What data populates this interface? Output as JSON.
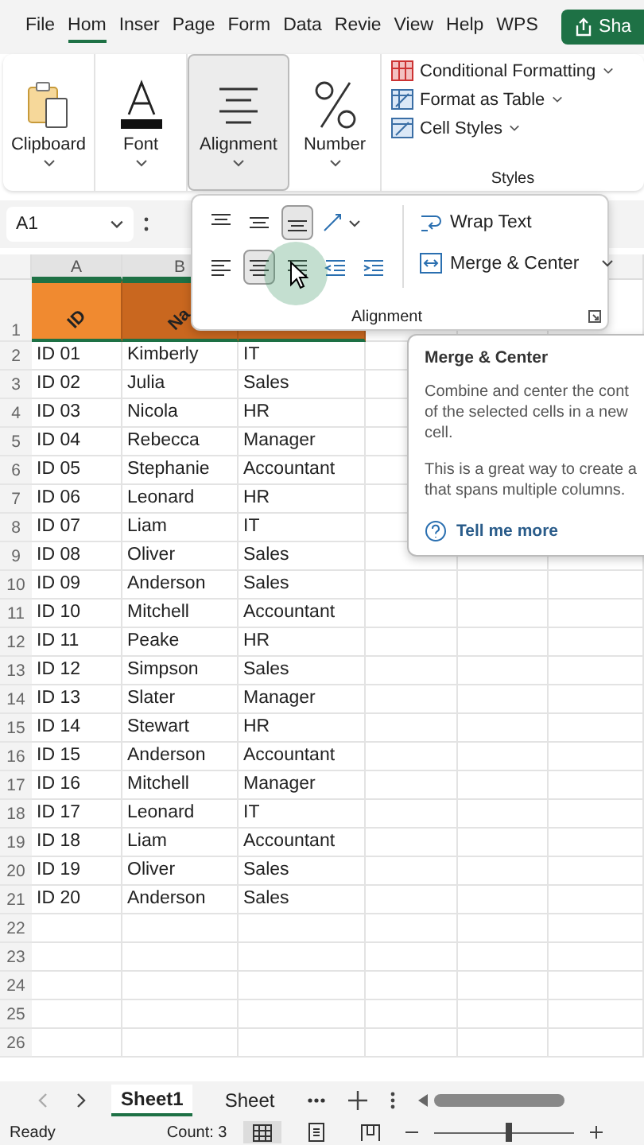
{
  "menu_tabs": [
    {
      "label": "File",
      "selected": false
    },
    {
      "label": "Hom",
      "selected": true
    },
    {
      "label": "Inser",
      "selected": false
    },
    {
      "label": "Page",
      "selected": false
    },
    {
      "label": "Form",
      "selected": false
    },
    {
      "label": "Data",
      "selected": false
    },
    {
      "label": "Revie",
      "selected": false
    },
    {
      "label": "View",
      "selected": false
    },
    {
      "label": "Help",
      "selected": false
    },
    {
      "label": "WPS",
      "selected": false
    }
  ],
  "share_button": "Sha",
  "ribbon_groups": [
    {
      "label": "Clipboard",
      "kind": "clipboard",
      "selected": false
    },
    {
      "label": "Font",
      "kind": "font",
      "selected": false
    },
    {
      "label": "Alignment",
      "kind": "alignment",
      "selected": true
    },
    {
      "label": "Number",
      "kind": "number",
      "selected": false
    }
  ],
  "styles": {
    "items": [
      {
        "label": "Conditional Formatting",
        "kind": "conditional"
      },
      {
        "label": "Format as Table",
        "kind": "table"
      },
      {
        "label": "Cell Styles",
        "kind": "cellstyles"
      }
    ],
    "label": "Styles"
  },
  "name_box": "A1",
  "alignment_popup": {
    "rows": [
      [
        {
          "kind": "top",
          "selected": false
        },
        {
          "kind": "middle",
          "selected": false
        },
        {
          "kind": "bottom",
          "selected": true
        },
        {
          "kind": "orientation",
          "selected": false
        }
      ],
      [
        {
          "kind": "left",
          "selected": false
        },
        {
          "kind": "center",
          "selected": true
        },
        {
          "kind": "right",
          "selected": false
        },
        {
          "kind": "outdent",
          "selected": false
        },
        {
          "kind": "indent",
          "selected": false
        }
      ]
    ],
    "wrap_text": "Wrap Text",
    "merge_center": "Merge & Center",
    "label": "Alignment"
  },
  "columns": [
    "A",
    "B"
  ],
  "header_row": {
    "n": "1",
    "cells": [
      {
        "text": "ID",
        "color": "#f08a30",
        "selected": true
      },
      {
        "text": "Na",
        "color": "#c9671f",
        "selected": true
      },
      {
        "color": "#c9671f",
        "selected": true
      }
    ]
  },
  "rows": [
    {
      "n": "2",
      "cells": [
        "ID 01",
        "Kimberly",
        "IT"
      ]
    },
    {
      "n": "3",
      "cells": [
        "ID 02",
        "Julia",
        "Sales"
      ]
    },
    {
      "n": "4",
      "cells": [
        "ID 03",
        "Nicola",
        "HR"
      ]
    },
    {
      "n": "5",
      "cells": [
        "ID 04",
        "Rebecca",
        "Manager"
      ]
    },
    {
      "n": "6",
      "cells": [
        "ID 05",
        "Stephanie",
        "Accountant"
      ]
    },
    {
      "n": "7",
      "cells": [
        "ID 06",
        "Leonard",
        "HR"
      ]
    },
    {
      "n": "8",
      "cells": [
        "ID 07",
        "Liam",
        "IT"
      ]
    },
    {
      "n": "9",
      "cells": [
        "ID 08",
        "Oliver",
        "Sales"
      ]
    },
    {
      "n": "10",
      "cells": [
        "ID 09",
        "Anderson",
        "Sales"
      ]
    },
    {
      "n": "11",
      "cells": [
        "ID 10",
        "Mitchell",
        "Accountant"
      ]
    },
    {
      "n": "12",
      "cells": [
        "ID 11",
        "Peake",
        "HR"
      ]
    },
    {
      "n": "13",
      "cells": [
        "ID 12",
        "Simpson",
        "Sales"
      ]
    },
    {
      "n": "14",
      "cells": [
        "ID 13",
        "Slater",
        "Manager"
      ]
    },
    {
      "n": "15",
      "cells": [
        "ID 14",
        "Stewart",
        "HR"
      ]
    },
    {
      "n": "16",
      "cells": [
        "ID 15",
        "Anderson",
        "Accountant"
      ]
    },
    {
      "n": "17",
      "cells": [
        "ID 16",
        "Mitchell",
        "Manager"
      ]
    },
    {
      "n": "18",
      "cells": [
        "ID 17",
        "Leonard",
        "IT"
      ]
    },
    {
      "n": "19",
      "cells": [
        "ID 18",
        "Liam",
        "Accountant"
      ]
    },
    {
      "n": "20",
      "cells": [
        "ID 19",
        "Oliver",
        "Sales"
      ]
    },
    {
      "n": "21",
      "cells": [
        "ID 20",
        "Anderson",
        "Sales"
      ]
    },
    {
      "n": "22",
      "cells": []
    },
    {
      "n": "23",
      "cells": []
    },
    {
      "n": "24",
      "cells": []
    },
    {
      "n": "25",
      "cells": []
    },
    {
      "n": "26",
      "cells": []
    }
  ],
  "tooltip": {
    "title": "Merge & Center",
    "paragraphs": [
      [
        "Combine and center the cont",
        "of the selected cells in a new",
        "cell."
      ],
      [
        "This is a great way to create a",
        "that spans multiple columns."
      ]
    ],
    "link": "Tell me more"
  },
  "sheet_tabs": [
    {
      "label": "Sheet1",
      "selected": true
    },
    {
      "label": "Sheet",
      "selected": false
    }
  ],
  "status_bar": {
    "ready": "Ready",
    "count": "Count: 3",
    "views": [
      {
        "kind": "normal",
        "selected": true
      },
      {
        "kind": "page",
        "selected": false
      },
      {
        "kind": "break",
        "selected": false
      }
    ],
    "zoom": {
      "level": 0.52
    }
  }
}
